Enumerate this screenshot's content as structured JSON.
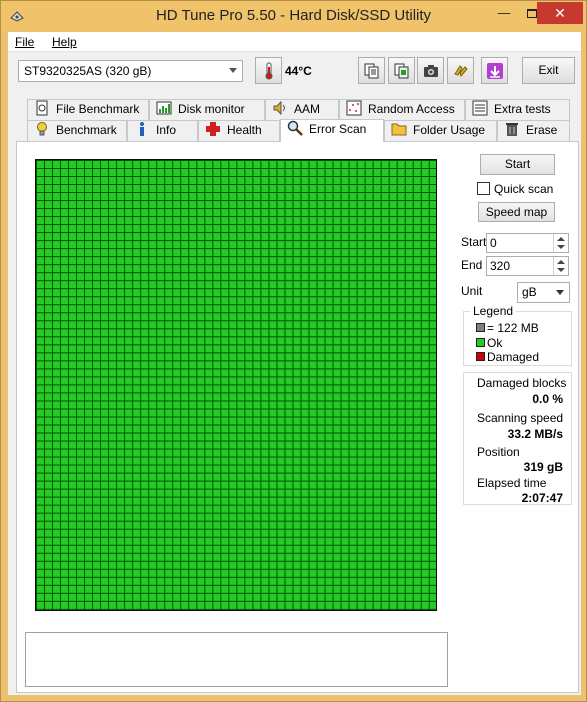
{
  "window": {
    "title": "HD Tune Pro 5.50 - Hard Disk/SSD Utility",
    "close_glyph": "✕",
    "minimize_glyph": "—"
  },
  "menu": {
    "file": "File",
    "help": "Help"
  },
  "toolbar": {
    "drive": "ST9320325AS (320 gB)",
    "temperature": "44°C",
    "exit_label": "Exit",
    "icons": [
      "thermometer-icon",
      "copy-text-icon",
      "copy-screenshot-icon",
      "camera-icon",
      "options-icon",
      "save-down-icon"
    ]
  },
  "tabs": {
    "row1": [
      "File Benchmark",
      "Disk monitor",
      "AAM",
      "Random Access",
      "Extra tests"
    ],
    "row2": [
      "Benchmark",
      "Info",
      "Health",
      "Error Scan",
      "Folder Usage",
      "Erase"
    ],
    "active": "Error Scan"
  },
  "controls": {
    "start_label": "Start",
    "quick_scan_label": "Quick scan",
    "quick_scan_checked": false,
    "speed_map_label": "Speed map",
    "start_field_label": "Start",
    "start_value": "0",
    "end_field_label": "End",
    "end_value": "320",
    "unit_label": "Unit",
    "unit_value": "gB"
  },
  "legend": {
    "title": "Legend",
    "block_size": "= 122 MB",
    "ok": "Ok",
    "damaged": "Damaged",
    "colors": {
      "block": "#808080",
      "ok": "#22cc22",
      "damaged": "#cc0000"
    }
  },
  "stats": {
    "damaged_label": "Damaged blocks",
    "damaged_value": "0.0 %",
    "speed_label": "Scanning speed",
    "speed_value": "33.2 MB/s",
    "position_label": "Position",
    "position_value": "319 gB",
    "elapsed_label": "Elapsed time",
    "elapsed_value": "2:07:47"
  },
  "scan_map": {
    "status": "ok",
    "progress_fraction": 1.0
  }
}
